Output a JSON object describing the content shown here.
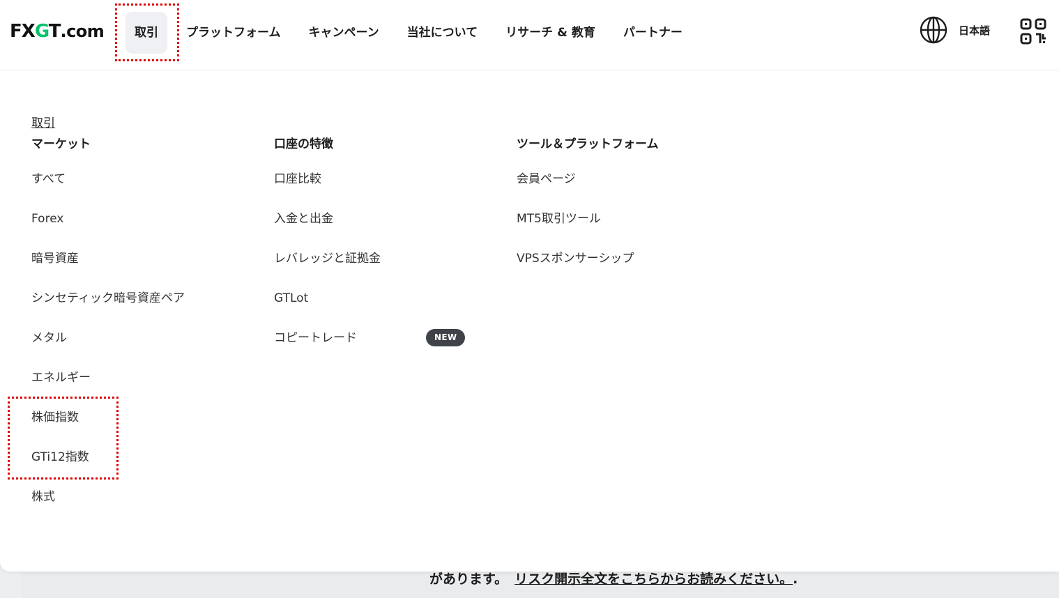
{
  "header": {
    "logo": {
      "fx": "FX",
      "g": "G",
      "t": "T",
      "com": ".com"
    },
    "nav": [
      {
        "label": "取引",
        "active": true
      },
      {
        "label": "プラットフォーム"
      },
      {
        "label": "キャンペーン"
      },
      {
        "label": "当社について"
      },
      {
        "label": "リサーチ & 教育"
      },
      {
        "label": "パートナー"
      }
    ],
    "language": "日本語",
    "icons": {
      "language": "globe-icon",
      "qr": "qr-code-icon"
    }
  },
  "menu": {
    "breadcrumb": "取引",
    "columns": [
      {
        "title": "マーケット",
        "items": [
          "すべて",
          "Forex",
          "暗号資産",
          "シンセティック暗号資産ペア",
          "メタル",
          "エネルギー",
          "株価指数",
          "GTi12指数",
          "株式"
        ]
      },
      {
        "title": "口座の特徴",
        "items": [
          "口座比較",
          "入金と出金",
          "レバレッジと証拠金",
          "GTLot",
          "コピートレード"
        ],
        "badge": "NEW"
      },
      {
        "title": "ツール＆プラットフォーム",
        "items": [
          "会員ページ",
          "MT5取引ツール",
          "VPSスポンサーシップ"
        ]
      }
    ]
  },
  "background": {
    "text": "があります。",
    "link": "リスク開示全文をこちらからお読みください。",
    "suffix": "."
  },
  "colors": {
    "brand_green": "#0bc26c",
    "highlight_red": "#e00000",
    "badge_bg": "#3f4349",
    "active_nav_bg": "#eef0f3"
  }
}
